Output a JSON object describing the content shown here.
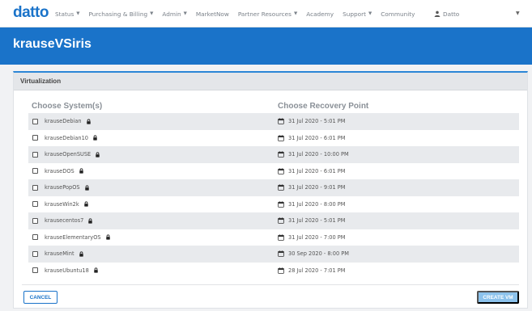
{
  "nav": {
    "logo": "datto",
    "items": [
      {
        "label": "Status",
        "dropdown": true
      },
      {
        "label": "Purchasing & Billing",
        "dropdown": true
      },
      {
        "label": "Admin",
        "dropdown": true
      },
      {
        "label": "MarketNow",
        "dropdown": false
      },
      {
        "label": "Partner Resources",
        "dropdown": true
      },
      {
        "label": "Academy",
        "dropdown": false
      },
      {
        "label": "Support",
        "dropdown": true
      },
      {
        "label": "Community",
        "dropdown": false
      }
    ],
    "user": "Datto"
  },
  "page": {
    "title": "krauseVSiris"
  },
  "panel": {
    "title": "Virtualization",
    "col_system": "Choose System(s)",
    "col_recovery": "Choose Recovery Point",
    "rows": [
      {
        "system": "krauseDebian",
        "recovery_point": "31 Jul 2020 - 5:01 PM"
      },
      {
        "system": "krauseDebian10",
        "recovery_point": "31 Jul 2020 - 6:01 PM"
      },
      {
        "system": "krauseOpenSUSE",
        "recovery_point": "31 Jul 2020 - 10:00 PM"
      },
      {
        "system": "krauseDOS",
        "recovery_point": "31 Jul 2020 - 6:01 PM"
      },
      {
        "system": "krausePopOS",
        "recovery_point": "31 Jul 2020 - 9:01 PM"
      },
      {
        "system": "krauseWin2k",
        "recovery_point": "31 Jul 2020 - 8:00 PM"
      },
      {
        "system": "krausecentos7",
        "recovery_point": "31 Jul 2020 - 5:01 PM"
      },
      {
        "system": "krauseElementaryOS",
        "recovery_point": "31 Jul 2020 - 7:00 PM"
      },
      {
        "system": "krauseMint",
        "recovery_point": "30 Sep 2020 - 8:00 PM"
      },
      {
        "system": "krauseUbuntu18",
        "recovery_point": "28 Jul 2020 - 7:01 PM"
      }
    ],
    "cancel_label": "CANCEL",
    "create_label": "CREATE VM"
  },
  "colors": {
    "brand_blue": "#1a73c9",
    "create_disabled": "#8cc2ec",
    "row_stripe": "#e8eaed"
  },
  "icons": {
    "lock": "lock-icon",
    "calendar": "calendar-icon",
    "user": "user-icon"
  }
}
